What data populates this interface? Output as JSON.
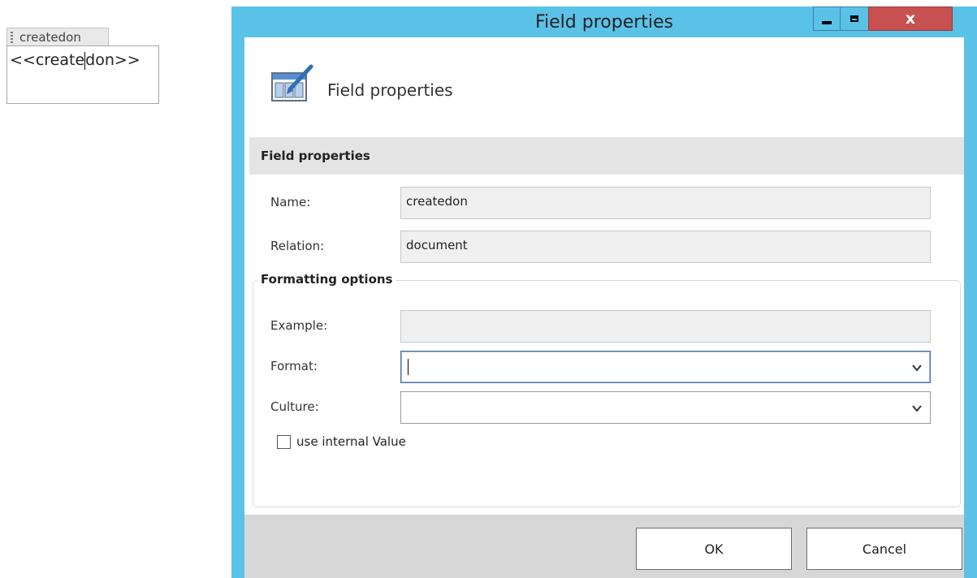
{
  "content_control": {
    "tag_label": "createdon",
    "text_before_caret": "<<create",
    "text_after_caret": "don>>"
  },
  "window": {
    "title": "Field properties",
    "close_glyph": "x",
    "controls": [
      "minimize-icon",
      "maximize-icon",
      "close-icon"
    ]
  },
  "header": {
    "icon": "table-edit-icon",
    "title": "Field properties"
  },
  "field_section": {
    "title": "Field properties",
    "name_label": "Name:",
    "name_value": "createdon",
    "relation_label": "Relation:",
    "relation_value": "document"
  },
  "formatting": {
    "legend": "Formatting options",
    "example_label": "Example:",
    "example_value": "",
    "format_label": "Format:",
    "format_value": "",
    "culture_label": "Culture:",
    "culture_value": "",
    "checkbox_label": "use internal Value",
    "checkbox_checked": false
  },
  "buttons": {
    "ok": "OK",
    "cancel": "Cancel"
  },
  "colors": {
    "titlebar": "#5bc2e7",
    "close_button": "#c75050",
    "section_bar": "#e4e4e4",
    "footer": "#d7d7d7"
  }
}
